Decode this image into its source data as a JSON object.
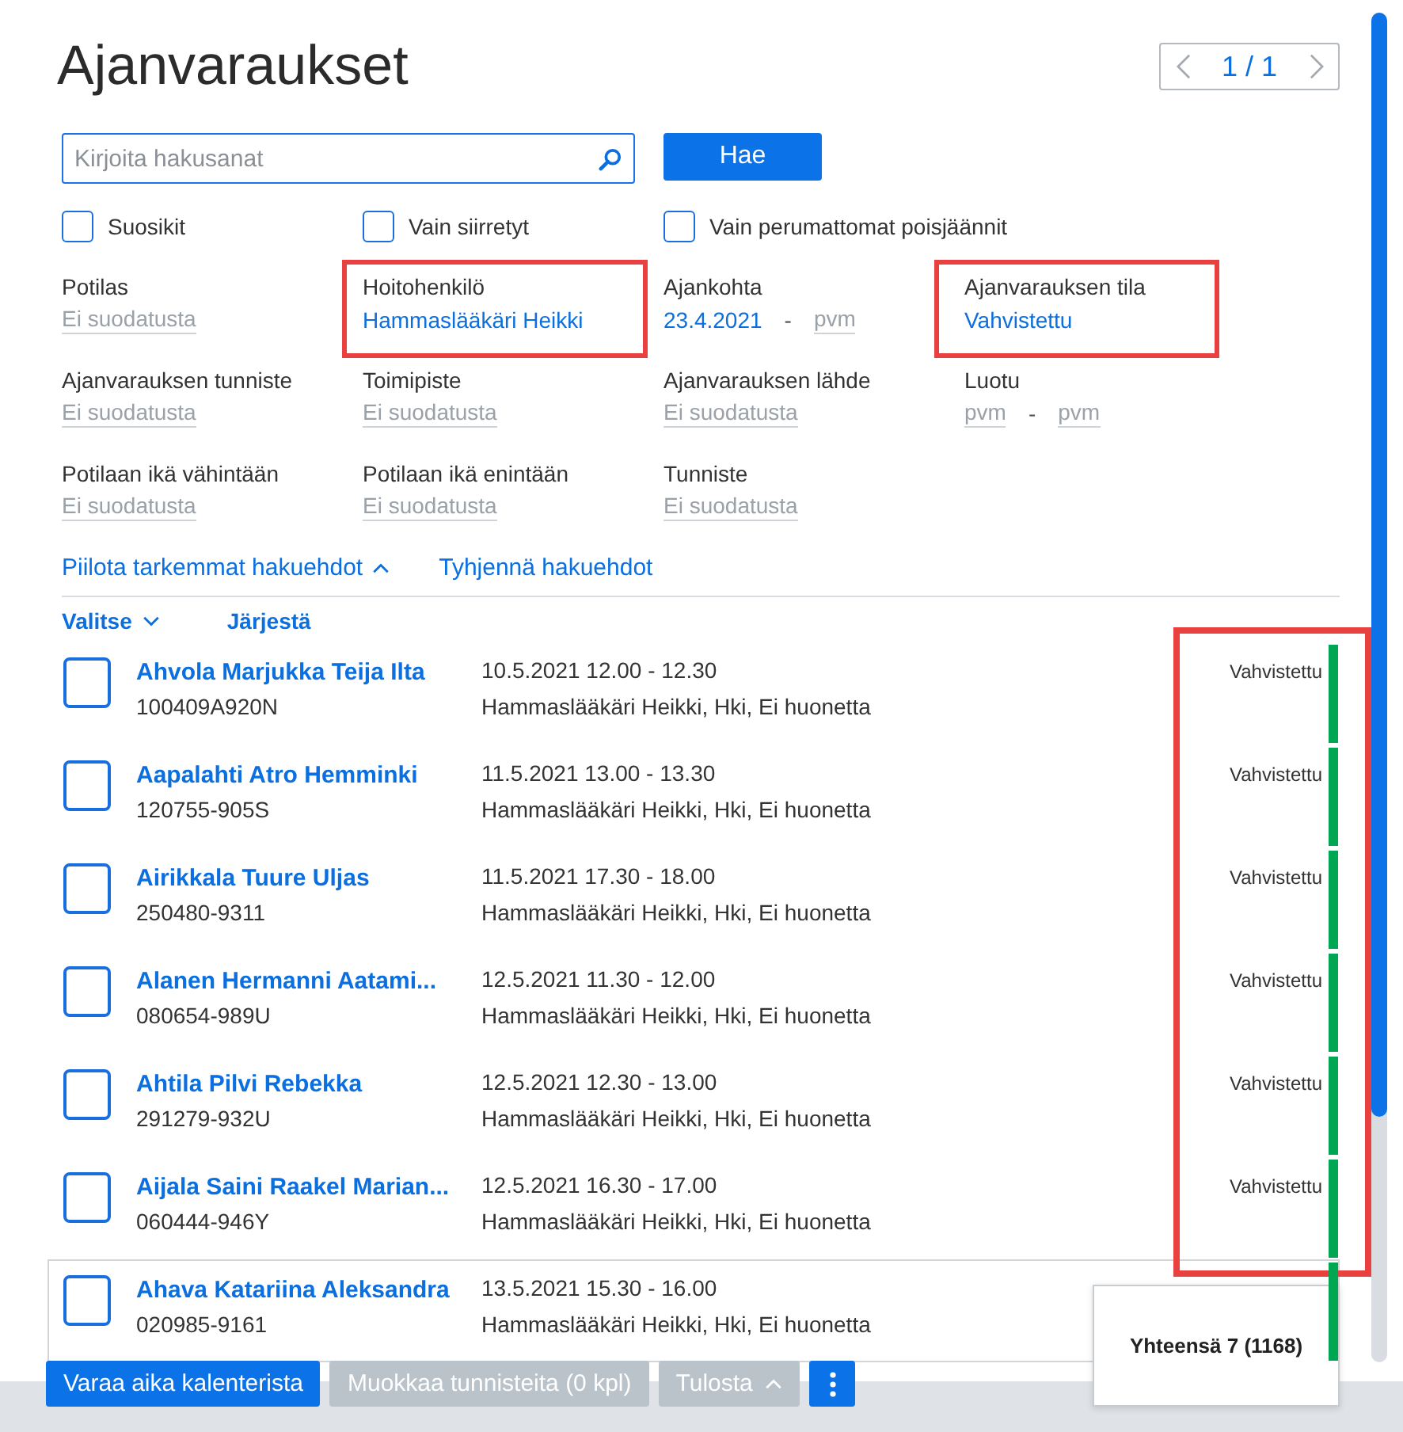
{
  "page": {
    "title": "Ajanvaraukset"
  },
  "pager": {
    "label": "1 / 1",
    "prev_disabled": true,
    "next_disabled": true
  },
  "search": {
    "placeholder": "Kirjoita hakusanat",
    "button": "Hae"
  },
  "checkboxes": [
    {
      "label": "Suosikit",
      "checked": false
    },
    {
      "label": "Vain siirretyt",
      "checked": false
    },
    {
      "label": "Vain perumattomat poisjäännit",
      "checked": false
    }
  ],
  "filters": [
    {
      "kind": "single",
      "label": "Potilas",
      "highlighted": false,
      "field": {
        "placeholder": "Ei suodatusta"
      }
    },
    {
      "kind": "single",
      "label": "Hoitohenkilö",
      "highlighted": true,
      "field": {
        "value": "Hammaslääkäri Heikki"
      }
    },
    {
      "kind": "range",
      "label": "Ajankohta",
      "highlighted": false,
      "from": {
        "value": "23.4.2021"
      },
      "separator": "-",
      "to": {
        "placeholder": "pvm"
      }
    },
    {
      "kind": "single",
      "label": "Ajanvarauksen tila",
      "highlighted": true,
      "field": {
        "value": "Vahvistettu"
      }
    },
    {
      "kind": "single",
      "label": "Ajanvarauksen tunniste",
      "highlighted": false,
      "field": {
        "placeholder": "Ei suodatusta"
      }
    },
    {
      "kind": "single",
      "label": "Toimipiste",
      "highlighted": false,
      "field": {
        "placeholder": "Ei suodatusta"
      }
    },
    {
      "kind": "single",
      "label": "Ajanvarauksen lähde",
      "highlighted": false,
      "field": {
        "placeholder": "Ei suodatusta"
      }
    },
    {
      "kind": "range",
      "label": "Luotu",
      "highlighted": false,
      "from": {
        "placeholder": "pvm"
      },
      "separator": "-",
      "to": {
        "placeholder": "pvm"
      }
    },
    {
      "kind": "single",
      "label": "Potilaan ikä vähintään",
      "highlighted": false,
      "field": {
        "placeholder": "Ei suodatusta"
      }
    },
    {
      "kind": "single",
      "label": "Potilaan ikä enintään",
      "highlighted": false,
      "field": {
        "placeholder": "Ei suodatusta"
      }
    },
    {
      "kind": "single",
      "label": "Tunniste",
      "highlighted": false,
      "field": {
        "placeholder": "Ei suodatusta"
      }
    }
  ],
  "filter_links": {
    "hide": "Piilota tarkemmat hakuehdot",
    "expanded": true,
    "clear": "Tyhjennä hakuehdot"
  },
  "list_toolbar": {
    "select": "Valitse",
    "sort": "Järjestä"
  },
  "status_column_highlighted": true,
  "appointments": [
    {
      "name": "Ahvola Marjukka Teija Ilta",
      "id": "100409A920N",
      "time": "10.5.2021 12.00 - 12.30",
      "place": "Hammaslääkäri Heikki, Hki, Ei huonetta",
      "status": "Vahvistettu",
      "color": "#00a651",
      "checked": false,
      "hovered": false
    },
    {
      "name": "Aapalahti Atro Hemminki",
      "id": "120755-905S",
      "time": "11.5.2021 13.00 - 13.30",
      "place": "Hammaslääkäri Heikki, Hki, Ei huonetta",
      "status": "Vahvistettu",
      "color": "#00a651",
      "checked": false,
      "hovered": false
    },
    {
      "name": "Airikkala Tuure Uljas",
      "id": "250480-9311",
      "time": "11.5.2021 17.30 - 18.00",
      "place": "Hammaslääkäri Heikki, Hki, Ei huonetta",
      "status": "Vahvistettu",
      "color": "#00a651",
      "checked": false,
      "hovered": false
    },
    {
      "name": "Alanen Hermanni Aatami...",
      "id": "080654-989U",
      "time": "12.5.2021 11.30 - 12.00",
      "place": "Hammaslääkäri Heikki, Hki, Ei huonetta",
      "status": "Vahvistettu",
      "color": "#00a651",
      "checked": false,
      "hovered": false
    },
    {
      "name": "Ahtila Pilvi Rebekka",
      "id": "291279-932U",
      "time": "12.5.2021 12.30 - 13.00",
      "place": "Hammaslääkäri Heikki, Hki, Ei huonetta",
      "status": "Vahvistettu",
      "color": "#00a651",
      "checked": false,
      "hovered": false
    },
    {
      "name": "Aijala Saini Raakel Marian...",
      "id": "060444-946Y",
      "time": "12.5.2021 16.30 - 17.00",
      "place": "Hammaslääkäri Heikki, Hki, Ei huonetta",
      "status": "Vahvistettu",
      "color": "#00a651",
      "checked": false,
      "hovered": false
    },
    {
      "name": "Ahava Katariina Aleksandra",
      "id": "020985-9161",
      "time": "13.5.2021 15.30 - 16.00",
      "place": "Hammaslääkäri Heikki, Hki, Ei huonetta",
      "color": "#00a651",
      "checked": false,
      "hovered": true
    }
  ],
  "summary": {
    "text": "Yhteensä 7 (1168)"
  },
  "actions": [
    {
      "kind": "plain",
      "label": "Varaa aika kalenterista",
      "disabled": false
    },
    {
      "kind": "plain",
      "label": "Muokkaa tunnisteita (0 kpl)",
      "disabled": true
    },
    {
      "kind": "dropdown",
      "label": "Tulosta",
      "disabled": true
    },
    {
      "kind": "more",
      "disabled": false
    }
  ]
}
